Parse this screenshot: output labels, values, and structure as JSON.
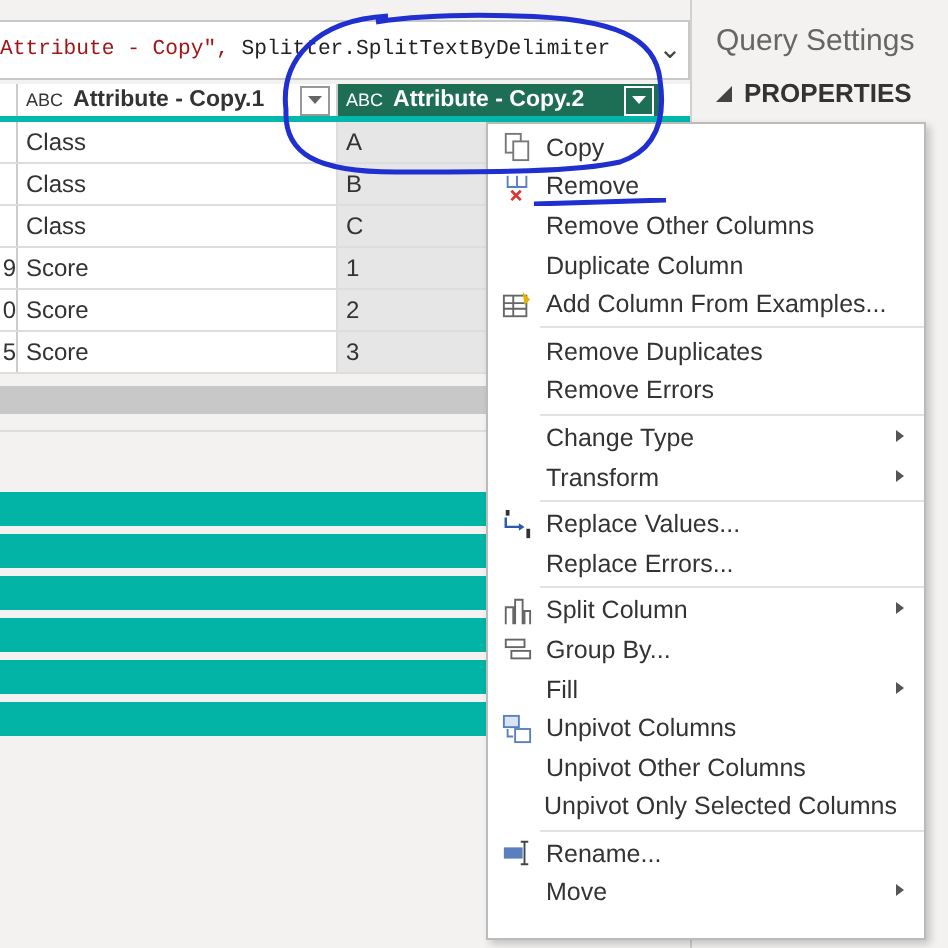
{
  "formula_bar": {
    "string_part": "Attribute - Copy\",",
    "rest": " Splitter.SplitTextByDelimiter",
    "chevron": "⌄"
  },
  "query_settings": {
    "title": "Query Settings",
    "section": "PROPERTIES"
  },
  "table": {
    "columns": [
      {
        "type_label": "ABC",
        "label": "Attribute - Copy.1",
        "selected": false
      },
      {
        "type_label": "ABC",
        "label": "Attribute - Copy.2",
        "selected": true
      }
    ],
    "rows": [
      {
        "index": "",
        "cells": [
          "Class",
          "A"
        ]
      },
      {
        "index": "",
        "cells": [
          "Class",
          "B"
        ]
      },
      {
        "index": "",
        "cells": [
          "Class",
          "C"
        ]
      },
      {
        "index": "9",
        "cells": [
          "Score",
          "1"
        ]
      },
      {
        "index": "0",
        "cells": [
          "Score",
          "2"
        ]
      },
      {
        "index": "5",
        "cells": [
          "Score",
          "3"
        ]
      }
    ]
  },
  "context_menu": [
    {
      "kind": "item",
      "label": "Copy",
      "submenu": false
    },
    {
      "kind": "item",
      "label": "Remove",
      "submenu": false
    },
    {
      "kind": "item",
      "label": "Remove Other Columns",
      "submenu": false
    },
    {
      "kind": "item",
      "label": "Duplicate Column",
      "submenu": false
    },
    {
      "kind": "item",
      "label": "Add Column From Examples...",
      "submenu": false
    },
    {
      "kind": "separator"
    },
    {
      "kind": "item",
      "label": "Remove Duplicates",
      "submenu": false
    },
    {
      "kind": "item",
      "label": "Remove Errors",
      "submenu": false
    },
    {
      "kind": "separator"
    },
    {
      "kind": "item",
      "label": "Change Type",
      "submenu": true
    },
    {
      "kind": "item",
      "label": "Transform",
      "submenu": true
    },
    {
      "kind": "separator"
    },
    {
      "kind": "item",
      "label": "Replace Values...",
      "submenu": false
    },
    {
      "kind": "item",
      "label": "Replace Errors...",
      "submenu": false
    },
    {
      "kind": "separator"
    },
    {
      "kind": "item",
      "label": "Split Column",
      "submenu": true
    },
    {
      "kind": "item",
      "label": "Group By...",
      "submenu": false
    },
    {
      "kind": "item",
      "label": "Fill",
      "submenu": true
    },
    {
      "kind": "item",
      "label": "Unpivot Columns",
      "submenu": false
    },
    {
      "kind": "item",
      "label": "Unpivot Other Columns",
      "submenu": false
    },
    {
      "kind": "item",
      "label": "Unpivot Only Selected Columns",
      "submenu": false
    },
    {
      "kind": "separator"
    },
    {
      "kind": "item",
      "label": "Rename...",
      "submenu": false
    },
    {
      "kind": "item",
      "label": "Move",
      "submenu": true
    }
  ]
}
